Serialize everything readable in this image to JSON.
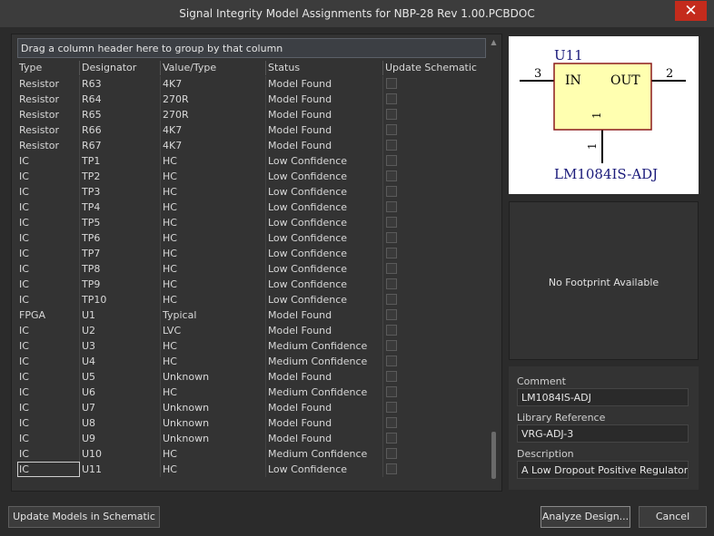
{
  "window": {
    "title": "Signal Integrity Model Assignments for NBP-28 Rev 1.00.PCBDOC",
    "close_label": "✕"
  },
  "grid": {
    "group_hint": "Drag a column header here to group by that column",
    "columns": [
      "Type",
      "Designator",
      "Value/Type",
      "Status",
      "Update Schematic"
    ],
    "rows": [
      [
        "Resistor",
        "R63",
        "4K7",
        "Model Found"
      ],
      [
        "Resistor",
        "R64",
        "270R",
        "Model Found"
      ],
      [
        "Resistor",
        "R65",
        "270R",
        "Model Found"
      ],
      [
        "Resistor",
        "R66",
        "4K7",
        "Model Found"
      ],
      [
        "Resistor",
        "R67",
        "4K7",
        "Model Found"
      ],
      [
        "IC",
        "TP1",
        "HC",
        "Low Confidence"
      ],
      [
        "IC",
        "TP2",
        "HC",
        "Low Confidence"
      ],
      [
        "IC",
        "TP3",
        "HC",
        "Low Confidence"
      ],
      [
        "IC",
        "TP4",
        "HC",
        "Low Confidence"
      ],
      [
        "IC",
        "TP5",
        "HC",
        "Low Confidence"
      ],
      [
        "IC",
        "TP6",
        "HC",
        "Low Confidence"
      ],
      [
        "IC",
        "TP7",
        "HC",
        "Low Confidence"
      ],
      [
        "IC",
        "TP8",
        "HC",
        "Low Confidence"
      ],
      [
        "IC",
        "TP9",
        "HC",
        "Low Confidence"
      ],
      [
        "IC",
        "TP10",
        "HC",
        "Low Confidence"
      ],
      [
        "FPGA",
        "U1",
        "Typical",
        "Model Found"
      ],
      [
        "IC",
        "U2",
        "LVC",
        "Model Found"
      ],
      [
        "IC",
        "U3",
        "HC",
        "Medium Confidence"
      ],
      [
        "IC",
        "U4",
        "HC",
        "Medium Confidence"
      ],
      [
        "IC",
        "U5",
        "Unknown",
        "Model Found"
      ],
      [
        "IC",
        "U6",
        "HC",
        "Medium Confidence"
      ],
      [
        "IC",
        "U7",
        "Unknown",
        "Model Found"
      ],
      [
        "IC",
        "U8",
        "Unknown",
        "Model Found"
      ],
      [
        "IC",
        "U9",
        "Unknown",
        "Model Found"
      ],
      [
        "IC",
        "U10",
        "HC",
        "Medium Confidence"
      ],
      [
        "IC",
        "U11",
        "HC",
        "Low Confidence"
      ]
    ],
    "selected_row": 25
  },
  "symbol": {
    "designator": "U11",
    "pin_in_number": "3",
    "pin_in_label": "IN",
    "pin_out_number": "2",
    "pin_out_label": "OUT",
    "pin_bottom_number_a": "1",
    "pin_bottom_number_b": "1",
    "part_name": "LM1084IS-ADJ",
    "colors": {
      "body_fill": "#ffffb0",
      "body_stroke": "#8b1a1a",
      "text": "#1a1a7a",
      "pin": "#000000"
    }
  },
  "footprint": {
    "message": "No Footprint Available"
  },
  "properties": {
    "comment_label": "Comment",
    "comment_value": "LM1084IS-ADJ",
    "library_label": "Library Reference",
    "library_value": "VRG-ADJ-3",
    "description_label": "Description",
    "description_value": "A Low Dropout Positive Regulators"
  },
  "buttons": {
    "update_models": "Update Models in Schematic",
    "analyze": "Analyze Design...",
    "cancel": "Cancel"
  }
}
